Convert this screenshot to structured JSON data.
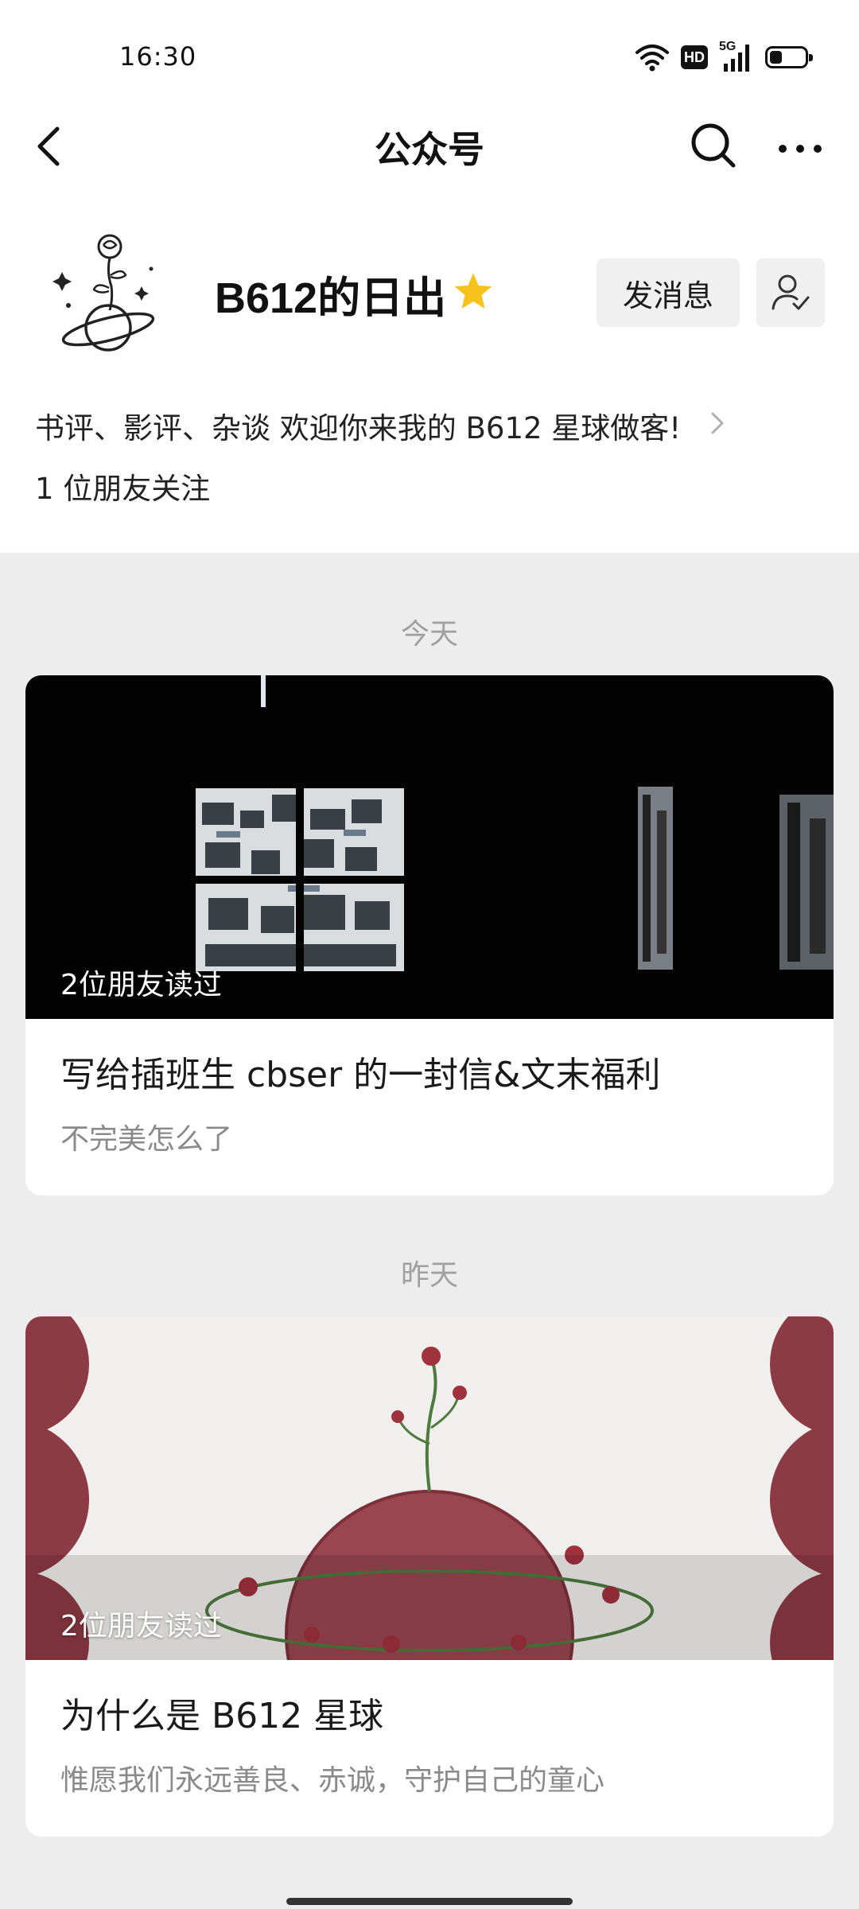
{
  "status_bar": {
    "time": "16:30",
    "icons": [
      "wifi-icon",
      "hd-icon",
      "signal-5g-icon",
      "battery-icon"
    ],
    "hd_label": "HD",
    "network_label": "5G",
    "battery_level": 0.35
  },
  "nav": {
    "title": "公众号",
    "icons": [
      "back-icon",
      "search-icon",
      "more-icon"
    ]
  },
  "profile": {
    "name": "B612的日出",
    "star_color": "#f7c21b",
    "message_button": "发消息",
    "description": "书评、影评、杂谈 欢迎你来我的 B612 星球做客!",
    "friends_follow": "1 位朋友关注"
  },
  "feed": [
    {
      "date": "今天",
      "read_by": "2位朋友读过",
      "title": "写给插班生 cbser 的一封信&文末福利",
      "subtitle": "不完美怎么了"
    },
    {
      "date": "昨天",
      "read_by": "2位朋友读过",
      "title": "为什么是 B612 星球",
      "subtitle": "惟愿我们永远善良、赤诚，守护自己的童心"
    }
  ],
  "colors": {
    "page_background": "#ededed",
    "card_background": "#ffffff",
    "button_background": "#f0f0f0",
    "secondary_text": "#8a8a8a"
  }
}
